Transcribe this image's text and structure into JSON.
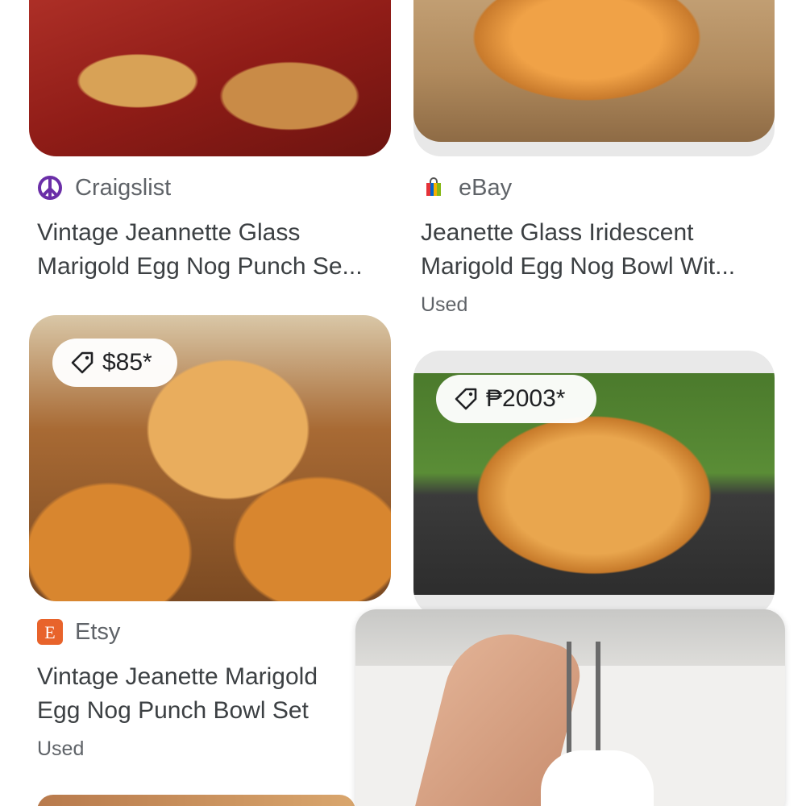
{
  "results": [
    {
      "source": "Craigslist",
      "source_icon": "peace-sign-icon",
      "title_line1": "Vintage Jeannette Glass",
      "title_line2": "Marigold Egg Nog Punch Se...",
      "condition": ""
    },
    {
      "source": "eBay",
      "source_icon": "shopping-bag-icon",
      "title_line1": "Jeanette Glass Iridescent",
      "title_line2": "Marigold Egg Nog Bowl Wit...",
      "condition": "Used"
    },
    {
      "source": "Etsy",
      "source_icon": "etsy-e-icon",
      "title_line1": "Vintage Jeanette Marigold",
      "title_line2": "Egg Nog Punch Bowl Set",
      "condition": "Used"
    }
  ],
  "price_chips": [
    {
      "price": "$85*"
    },
    {
      "price": "₱2003*"
    }
  ],
  "colors": {
    "craigslist_purple": "#6b2fa8",
    "etsy_orange": "#e8632b",
    "text_primary": "#3c4043",
    "text_secondary": "#5f6368"
  }
}
